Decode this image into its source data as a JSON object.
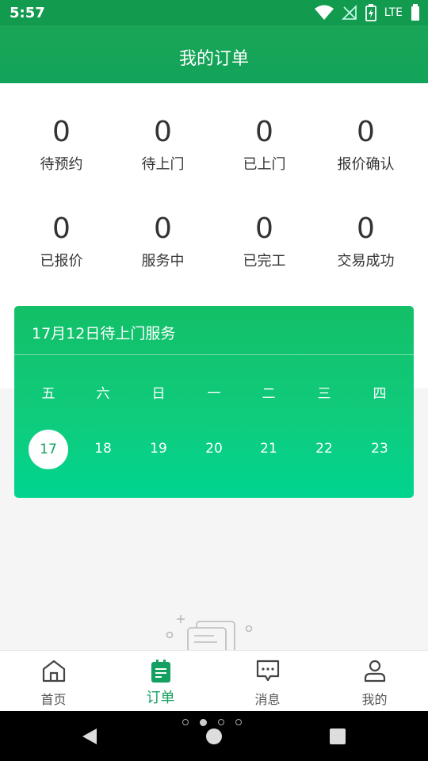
{
  "status": {
    "time": "5:57",
    "network": "LTE"
  },
  "header": {
    "title": "我的订单"
  },
  "stats": [
    {
      "count": "0",
      "label": "待预约"
    },
    {
      "count": "0",
      "label": "待上门"
    },
    {
      "count": "0",
      "label": "已上门"
    },
    {
      "count": "0",
      "label": "报价确认"
    },
    {
      "count": "0",
      "label": "已报价"
    },
    {
      "count": "0",
      "label": "服务中"
    },
    {
      "count": "0",
      "label": "已完工"
    },
    {
      "count": "0",
      "label": "交易成功"
    }
  ],
  "calendar": {
    "title": "17月12日待上门服务",
    "weekdays": [
      "五",
      "六",
      "日",
      "一",
      "二",
      "三",
      "四"
    ],
    "days": [
      "17",
      "18",
      "19",
      "20",
      "21",
      "22",
      "23"
    ],
    "selected_day": "17"
  },
  "tabs": [
    {
      "label": "首页",
      "icon": "home-icon"
    },
    {
      "label": "订单",
      "icon": "order-icon",
      "active": true
    },
    {
      "label": "消息",
      "icon": "message-icon"
    },
    {
      "label": "我的",
      "icon": "profile-icon"
    }
  ],
  "colors": {
    "primary": "#129a4f",
    "accent": "#14a060",
    "card_start": "#13bf67",
    "card_end": "#00d48f"
  }
}
